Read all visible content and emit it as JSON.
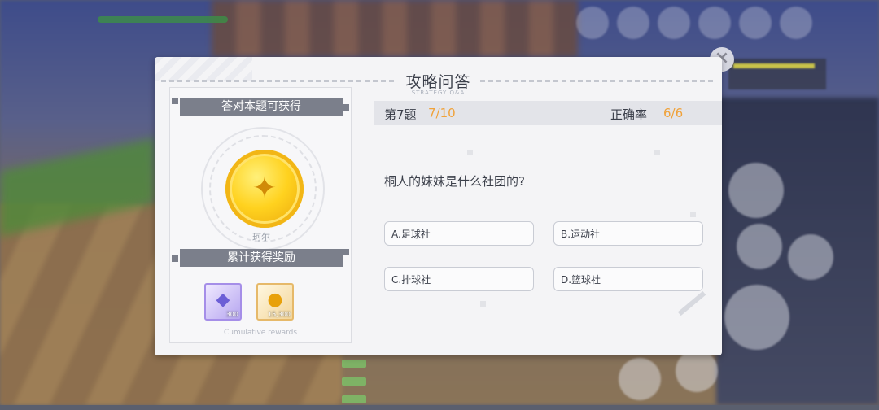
{
  "dialog": {
    "title": "攻略问答",
    "subtitle": "STRATEGY Q&A",
    "question_label": "第7题",
    "question_progress": "7/10",
    "accuracy_label": "正确率",
    "accuracy_value": "6/6",
    "question_text": "桐人的妹妹是什么社团的?",
    "options": [
      {
        "label": "A.足球社"
      },
      {
        "label": "B.运动社"
      },
      {
        "label": "C.排球社"
      },
      {
        "label": "D.篮球社"
      }
    ]
  },
  "reward_panel": {
    "answer_reward_header": "答对本题可获得",
    "reward_name": "珂尔",
    "cumulative_header": "累计获得奖励",
    "cumulative_caption": "Cumulative rewards",
    "items": [
      {
        "icon": "cube-icon",
        "count": "300"
      },
      {
        "icon": "gold-coin-icon",
        "count": "15,300"
      }
    ]
  },
  "colors": {
    "accent_orange": "#f0a23a",
    "header_gray": "#7b7f8b",
    "coin_gold": "#ffd21f"
  }
}
